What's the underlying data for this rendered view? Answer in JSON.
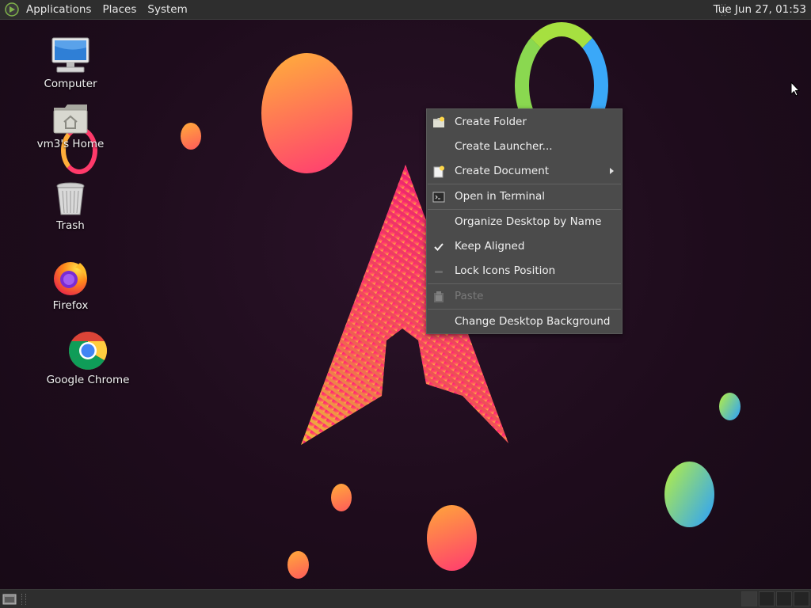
{
  "top_panel": {
    "menus": [
      "Applications",
      "Places",
      "System"
    ],
    "clock": "Tue Jun 27, 01:53"
  },
  "desktop_icons": [
    {
      "label": "Computer",
      "icon": "computer-icon"
    },
    {
      "label": "vm3's Home",
      "icon": "home-folder-icon"
    },
    {
      "label": "Trash",
      "icon": "trash-icon"
    },
    {
      "label": "Firefox",
      "icon": "firefox-icon"
    },
    {
      "label": "Google Chrome",
      "icon": "chrome-icon"
    }
  ],
  "context_menu": {
    "items": [
      {
        "label": "Create Folder",
        "icon": "new-folder-icon"
      },
      {
        "label": "Create Launcher...",
        "icon": ""
      },
      {
        "label": "Create Document",
        "icon": "new-document-icon",
        "submenu": true
      },
      {
        "label": "Open in Terminal",
        "icon": "terminal-icon"
      },
      {
        "label": "Organize Desktop by Name",
        "icon": ""
      },
      {
        "label": "Keep Aligned",
        "icon": "checkmark-icon",
        "checked": true
      },
      {
        "label": "Lock Icons Position",
        "icon": "lock-icon"
      },
      {
        "label": "Paste",
        "icon": "paste-icon",
        "disabled": true
      },
      {
        "label": "Change Desktop Background",
        "icon": ""
      }
    ]
  },
  "colors": {
    "panel_bg": "#2e2e2e",
    "menu_bg": "#4b4b4b",
    "desktop_bg": "#1e0c1c",
    "accent_pink": "#ff2e7e",
    "accent_orange": "#ff9a3c"
  }
}
